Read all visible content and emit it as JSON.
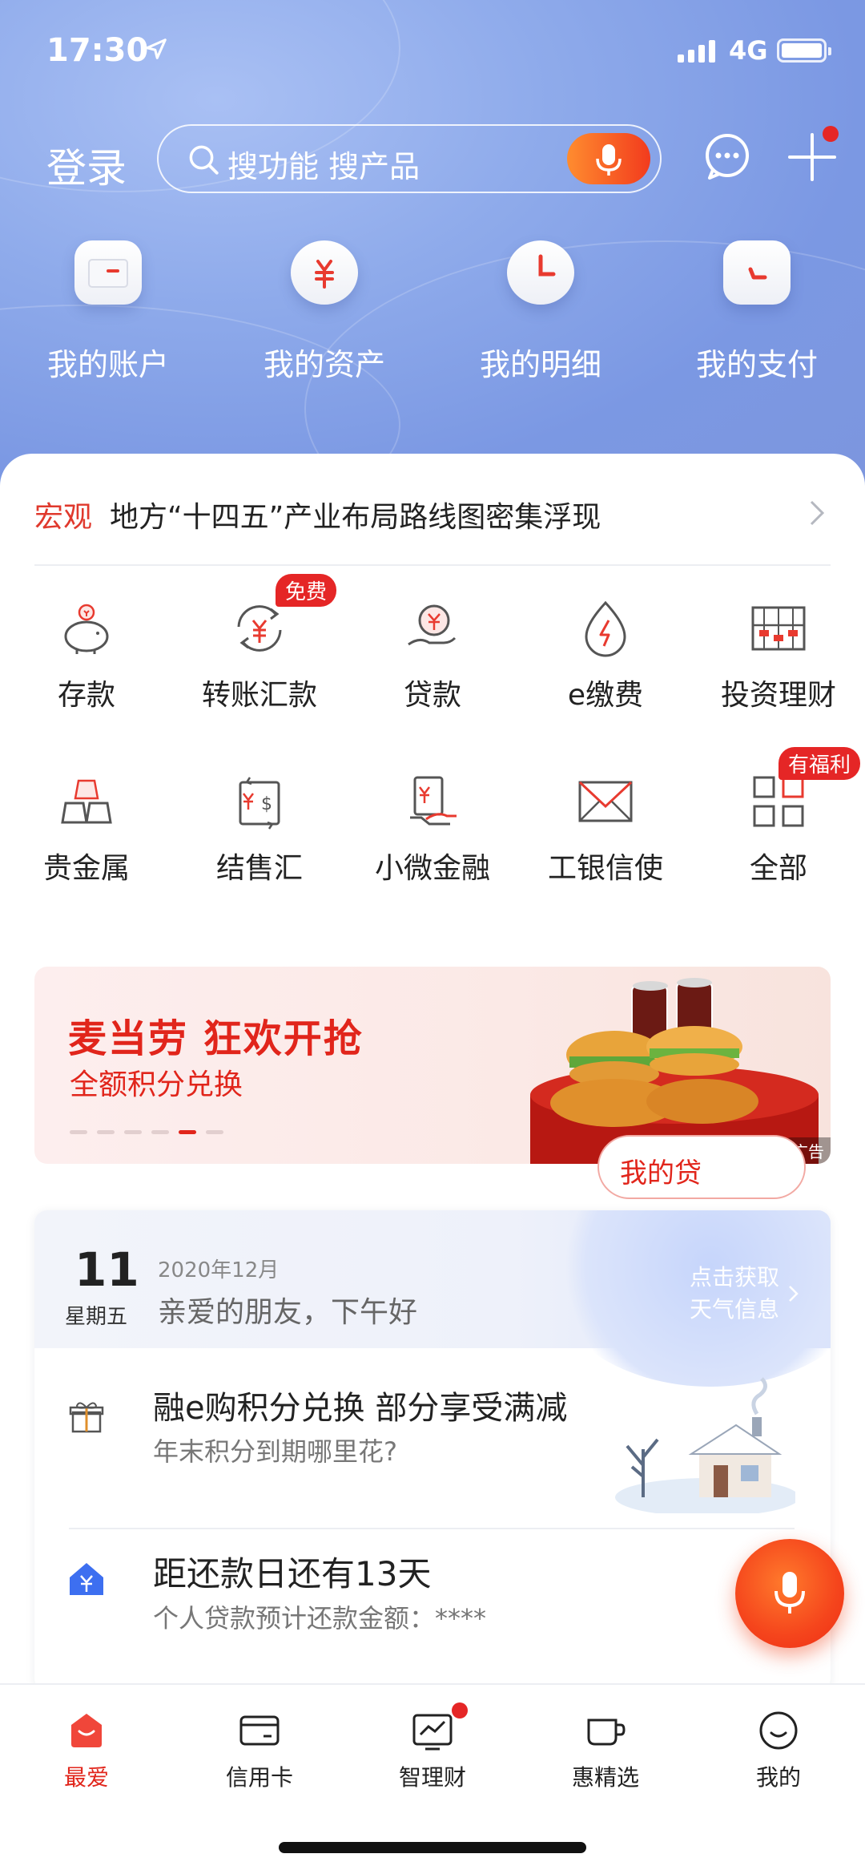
{
  "status": {
    "time": "17:30",
    "network": "4G"
  },
  "header": {
    "login_label": "登录",
    "search_placeholder": "搜功能 搜产品"
  },
  "quick": [
    {
      "label": "我的账户",
      "icon": "card-icon"
    },
    {
      "label": "我的资产",
      "icon": "yuan-icon"
    },
    {
      "label": "我的明细",
      "icon": "clock-icon"
    },
    {
      "label": "我的支付",
      "icon": "pay-icon"
    }
  ],
  "news": {
    "tag": "宏观",
    "title": "地方“十四五”产业布局路线图密集浮现"
  },
  "services": [
    {
      "label": "存款",
      "icon": "piggy-bank-icon"
    },
    {
      "label": "转账汇款",
      "icon": "transfer-icon",
      "badge": "免费"
    },
    {
      "label": "贷款",
      "icon": "loan-icon"
    },
    {
      "label": "e缴费",
      "icon": "bill-icon"
    },
    {
      "label": "投资理财",
      "icon": "abacus-icon"
    },
    {
      "label": "贵金属",
      "icon": "gold-bars-icon"
    },
    {
      "label": "结售汇",
      "icon": "exchange-icon"
    },
    {
      "label": "小微金融",
      "icon": "micro-finance-icon"
    },
    {
      "label": "工银信使",
      "icon": "envelope-icon"
    },
    {
      "label": "全部",
      "icon": "grid-icon",
      "badge": "有福利"
    }
  ],
  "banner": {
    "title": "麦当劳 狂欢开抢",
    "subtitle": "全额积分兑换",
    "ad_label": "广告",
    "active_dot": 4,
    "dot_count": 6
  },
  "info": {
    "day": "11",
    "weekday": "星期五",
    "month": "2020年12月",
    "greeting": "亲爱的朋友，下午好",
    "weather_line1": "点击获取",
    "weather_line2": "天气信息",
    "item1_title": "融e购积分兑换 部分享受满减",
    "item1_sub": "年末积分到期哪里花?",
    "item2_title": "距还款日还有13天",
    "item2_sub": "个人贷款预计还款金额：****",
    "item2_button": "我的贷"
  },
  "tabs": [
    {
      "label": "最爱",
      "active": true
    },
    {
      "label": "信用卡",
      "active": false
    },
    {
      "label": "智理财",
      "active": false
    },
    {
      "label": "惠精选",
      "active": false
    },
    {
      "label": "我的",
      "active": false
    }
  ],
  "colors": {
    "accent": "#e1251b",
    "hero": "#8fabeb"
  }
}
